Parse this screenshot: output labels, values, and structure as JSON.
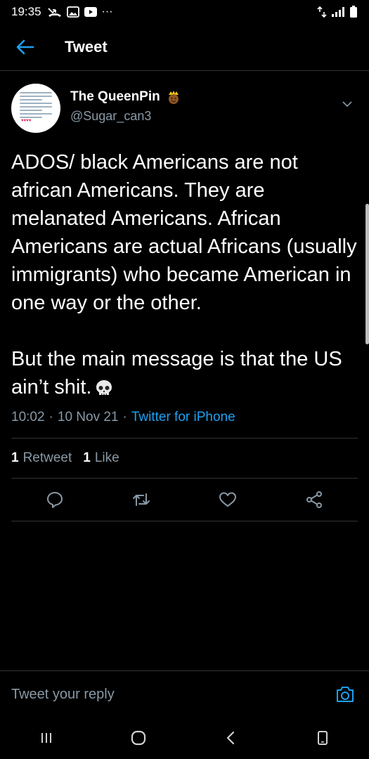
{
  "status_bar": {
    "time": "19:35",
    "overflow": "···",
    "left_icons": [
      "missed-call-icon",
      "gallery-icon",
      "youtube-icon"
    ],
    "right_icons": [
      "data-arrows-icon",
      "signal-icon",
      "battery-icon"
    ]
  },
  "header": {
    "title": "Tweet",
    "back_icon": "arrow-left-icon"
  },
  "tweet": {
    "display_name": "The QueenPin",
    "handle": "@Sugar_can3",
    "text": "ADOS/ black Americans are not african Americans. They are melanated Americans. African Americans are actual Africans (usually immigrants) who became American in one way or the other.\n\nBut the main message is that the US ain’t shit.",
    "time": "10:02",
    "date": "10 Nov 21",
    "separator": "·",
    "source": "Twitter for iPhone",
    "retweet_count": "1",
    "retweet_label": "Retweet",
    "like_count": "1",
    "like_label": "Like"
  },
  "actions": [
    "reply-icon",
    "retweet-icon",
    "like-icon",
    "share-icon"
  ],
  "reply": {
    "placeholder": "Tweet your reply"
  },
  "nav": [
    "recents-icon",
    "home-icon",
    "back-icon",
    "rotate-icon"
  ],
  "colors": {
    "background": "#000000",
    "accent": "#1da1f2",
    "secondary_text": "#8899a6",
    "divider": "#2f3336"
  }
}
